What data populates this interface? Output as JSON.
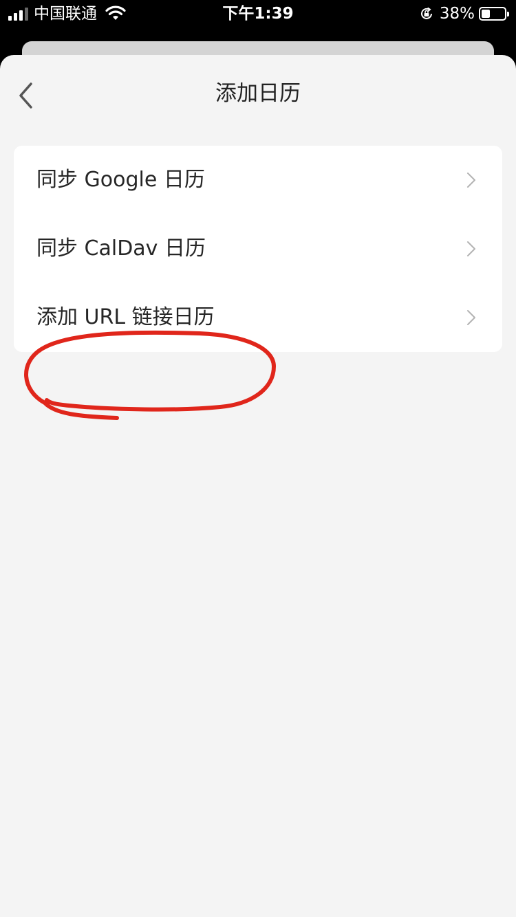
{
  "status_bar": {
    "carrier": "中国联通",
    "time": "下午1:39",
    "battery_percent": "38%",
    "battery_level": 0.38,
    "icons": [
      "signal-icon",
      "wifi-icon",
      "rotation-lock-icon",
      "battery-icon"
    ]
  },
  "nav": {
    "title": "添加日历",
    "back_icon": "chevron-left-icon"
  },
  "menu": {
    "items": [
      {
        "label": "同步 Google 日历",
        "icon": "chevron-right-icon"
      },
      {
        "label": "同步 CalDav 日历",
        "icon": "chevron-right-icon"
      },
      {
        "label": "添加 URL 链接日历",
        "icon": "chevron-right-icon",
        "highlighted": true
      }
    ]
  },
  "colors": {
    "sheet_background": "#f4f4f4",
    "card_background": "#ffffff",
    "annotation_red": "#e0261b",
    "status_bar_background": "#000000"
  }
}
